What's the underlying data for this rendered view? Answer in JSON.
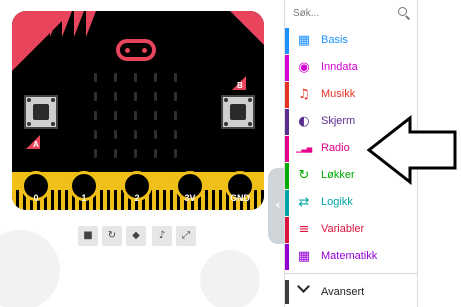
{
  "simulator": {
    "pins": [
      {
        "label": "0"
      },
      {
        "label": "1"
      },
      {
        "label": "2"
      },
      {
        "label": "3V"
      },
      {
        "label": "GND"
      }
    ],
    "button_a_label": "A",
    "button_b_label": "B",
    "controls": [
      {
        "icon": "stop-icon",
        "glyph": "■"
      },
      {
        "icon": "restart-icon",
        "glyph": "↻"
      },
      {
        "icon": "slow-motion-icon",
        "glyph": "◆"
      },
      {
        "icon": "mute-icon",
        "glyph": "♪"
      },
      {
        "icon": "fullscreen-icon",
        "glyph": "⤢"
      }
    ],
    "collapse_glyph": "‹",
    "colors": {
      "board": "#000000",
      "accent": "#e8445b",
      "edge": "#f0bf18"
    }
  },
  "toolbox": {
    "search_placeholder": "Søk...",
    "categories": [
      {
        "label": "Basis",
        "icon": "grid-icon",
        "color": "#1e90ff",
        "glyph": "▦"
      },
      {
        "label": "Inndata",
        "icon": "target-icon",
        "color": "#d400d4",
        "glyph": "◉"
      },
      {
        "label": "Musikk",
        "icon": "headphones-icon",
        "color": "#e63022",
        "glyph": "♫"
      },
      {
        "label": "Skjerm",
        "icon": "toggle-icon",
        "color": "#5c2d91",
        "glyph": "◐"
      },
      {
        "label": "Radio",
        "icon": "signal-bars-icon",
        "color": "#e3008c",
        "glyph": "▁▃▅"
      },
      {
        "label": "Løkker",
        "icon": "refresh-icon",
        "color": "#00aa00",
        "glyph": "↻"
      },
      {
        "label": "Logikk",
        "icon": "shuffle-icon",
        "color": "#00a4a6",
        "glyph": "⇄"
      },
      {
        "label": "Variabler",
        "icon": "list-icon",
        "color": "#dc143c",
        "glyph": "≡"
      },
      {
        "label": "Matematikk",
        "icon": "calculator-icon",
        "color": "#9400d3",
        "glyph": "▦"
      }
    ],
    "advanced_label": "Avansert"
  }
}
